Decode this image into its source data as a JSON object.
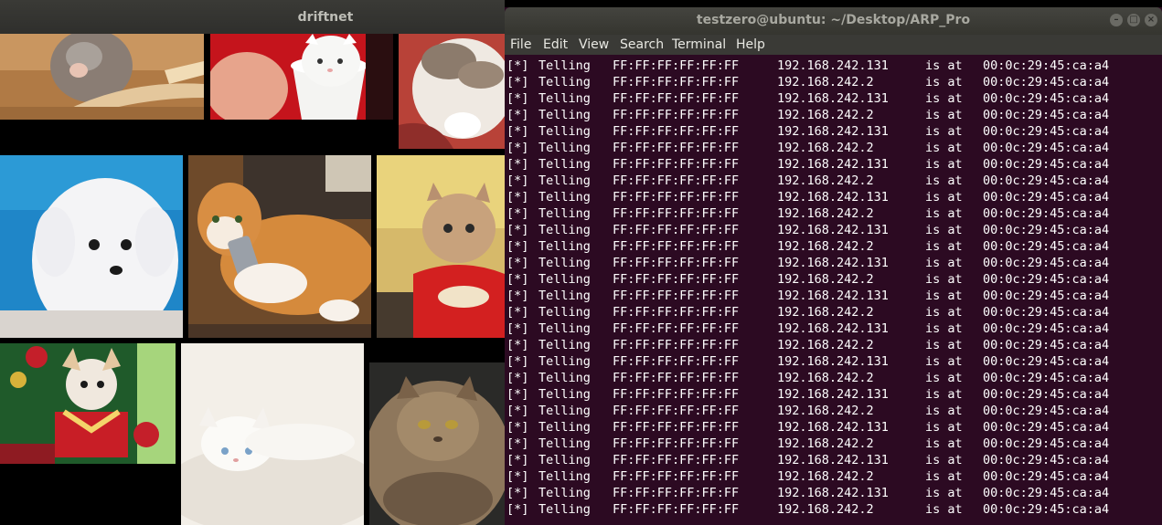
{
  "driftnet": {
    "title": "driftnet",
    "images": [
      "kitten licking paw on chair",
      "white kitten in cup",
      "calico cat on red blanket",
      "white fluffy puppy on blue background",
      "orange and white cat holding phone",
      "kitten in red sweater",
      "chihuahua with christmas gifts",
      "white kitten on blanket",
      "grumpy persian cat"
    ]
  },
  "terminal": {
    "title": "testzero@ubuntu: ~/Desktop/ARP_Pro",
    "menu": [
      "File",
      "Edit",
      "View",
      "Search",
      "Terminal",
      "Help"
    ],
    "lines": [
      {
        "prefix": "[*]",
        "verb": "Telling",
        "mac": "FF:FF:FF:FF:FF:FF",
        "ip": "192.168.242.131",
        "isat": "is at",
        "target": "00:0c:29:45:ca:a4"
      },
      {
        "prefix": "[*]",
        "verb": "Telling",
        "mac": "FF:FF:FF:FF:FF:FF",
        "ip": "192.168.242.2",
        "isat": "is at",
        "target": "00:0c:29:45:ca:a4"
      },
      {
        "prefix": "[*]",
        "verb": "Telling",
        "mac": "FF:FF:FF:FF:FF:FF",
        "ip": "192.168.242.131",
        "isat": "is at",
        "target": "00:0c:29:45:ca:a4"
      },
      {
        "prefix": "[*]",
        "verb": "Telling",
        "mac": "FF:FF:FF:FF:FF:FF",
        "ip": "192.168.242.2",
        "isat": "is at",
        "target": "00:0c:29:45:ca:a4"
      },
      {
        "prefix": "[*]",
        "verb": "Telling",
        "mac": "FF:FF:FF:FF:FF:FF",
        "ip": "192.168.242.131",
        "isat": "is at",
        "target": "00:0c:29:45:ca:a4"
      },
      {
        "prefix": "[*]",
        "verb": "Telling",
        "mac": "FF:FF:FF:FF:FF:FF",
        "ip": "192.168.242.2",
        "isat": "is at",
        "target": "00:0c:29:45:ca:a4"
      },
      {
        "prefix": "[*]",
        "verb": "Telling",
        "mac": "FF:FF:FF:FF:FF:FF",
        "ip": "192.168.242.131",
        "isat": "is at",
        "target": "00:0c:29:45:ca:a4"
      },
      {
        "prefix": "[*]",
        "verb": "Telling",
        "mac": "FF:FF:FF:FF:FF:FF",
        "ip": "192.168.242.2",
        "isat": "is at",
        "target": "00:0c:29:45:ca:a4"
      },
      {
        "prefix": "[*]",
        "verb": "Telling",
        "mac": "FF:FF:FF:FF:FF:FF",
        "ip": "192.168.242.131",
        "isat": "is at",
        "target": "00:0c:29:45:ca:a4"
      },
      {
        "prefix": "[*]",
        "verb": "Telling",
        "mac": "FF:FF:FF:FF:FF:FF",
        "ip": "192.168.242.2",
        "isat": "is at",
        "target": "00:0c:29:45:ca:a4"
      },
      {
        "prefix": "[*]",
        "verb": "Telling",
        "mac": "FF:FF:FF:FF:FF:FF",
        "ip": "192.168.242.131",
        "isat": "is at",
        "target": "00:0c:29:45:ca:a4"
      },
      {
        "prefix": "[*]",
        "verb": "Telling",
        "mac": "FF:FF:FF:FF:FF:FF",
        "ip": "192.168.242.2",
        "isat": "is at",
        "target": "00:0c:29:45:ca:a4"
      },
      {
        "prefix": "[*]",
        "verb": "Telling",
        "mac": "FF:FF:FF:FF:FF:FF",
        "ip": "192.168.242.131",
        "isat": "is at",
        "target": "00:0c:29:45:ca:a4"
      },
      {
        "prefix": "[*]",
        "verb": "Telling",
        "mac": "FF:FF:FF:FF:FF:FF",
        "ip": "192.168.242.2",
        "isat": "is at",
        "target": "00:0c:29:45:ca:a4"
      },
      {
        "prefix": "[*]",
        "verb": "Telling",
        "mac": "FF:FF:FF:FF:FF:FF",
        "ip": "192.168.242.131",
        "isat": "is at",
        "target": "00:0c:29:45:ca:a4"
      },
      {
        "prefix": "[*]",
        "verb": "Telling",
        "mac": "FF:FF:FF:FF:FF:FF",
        "ip": "192.168.242.2",
        "isat": "is at",
        "target": "00:0c:29:45:ca:a4"
      },
      {
        "prefix": "[*]",
        "verb": "Telling",
        "mac": "FF:FF:FF:FF:FF:FF",
        "ip": "192.168.242.131",
        "isat": "is at",
        "target": "00:0c:29:45:ca:a4"
      },
      {
        "prefix": "[*]",
        "verb": "Telling",
        "mac": "FF:FF:FF:FF:FF:FF",
        "ip": "192.168.242.2",
        "isat": "is at",
        "target": "00:0c:29:45:ca:a4"
      },
      {
        "prefix": "[*]",
        "verb": "Telling",
        "mac": "FF:FF:FF:FF:FF:FF",
        "ip": "192.168.242.131",
        "isat": "is at",
        "target": "00:0c:29:45:ca:a4"
      },
      {
        "prefix": "[*]",
        "verb": "Telling",
        "mac": "FF:FF:FF:FF:FF:FF",
        "ip": "192.168.242.2",
        "isat": "is at",
        "target": "00:0c:29:45:ca:a4"
      },
      {
        "prefix": "[*]",
        "verb": "Telling",
        "mac": "FF:FF:FF:FF:FF:FF",
        "ip": "192.168.242.131",
        "isat": "is at",
        "target": "00:0c:29:45:ca:a4"
      },
      {
        "prefix": "[*]",
        "verb": "Telling",
        "mac": "FF:FF:FF:FF:FF:FF",
        "ip": "192.168.242.2",
        "isat": "is at",
        "target": "00:0c:29:45:ca:a4"
      },
      {
        "prefix": "[*]",
        "verb": "Telling",
        "mac": "FF:FF:FF:FF:FF:FF",
        "ip": "192.168.242.131",
        "isat": "is at",
        "target": "00:0c:29:45:ca:a4"
      },
      {
        "prefix": "[*]",
        "verb": "Telling",
        "mac": "FF:FF:FF:FF:FF:FF",
        "ip": "192.168.242.2",
        "isat": "is at",
        "target": "00:0c:29:45:ca:a4"
      },
      {
        "prefix": "[*]",
        "verb": "Telling",
        "mac": "FF:FF:FF:FF:FF:FF",
        "ip": "192.168.242.131",
        "isat": "is at",
        "target": "00:0c:29:45:ca:a4"
      },
      {
        "prefix": "[*]",
        "verb": "Telling",
        "mac": "FF:FF:FF:FF:FF:FF",
        "ip": "192.168.242.2",
        "isat": "is at",
        "target": "00:0c:29:45:ca:a4"
      },
      {
        "prefix": "[*]",
        "verb": "Telling",
        "mac": "FF:FF:FF:FF:FF:FF",
        "ip": "192.168.242.131",
        "isat": "is at",
        "target": "00:0c:29:45:ca:a4"
      },
      {
        "prefix": "[*]",
        "verb": "Telling",
        "mac": "FF:FF:FF:FF:FF:FF",
        "ip": "192.168.242.2",
        "isat": "is at",
        "target": "00:0c:29:45:ca:a4"
      }
    ]
  }
}
